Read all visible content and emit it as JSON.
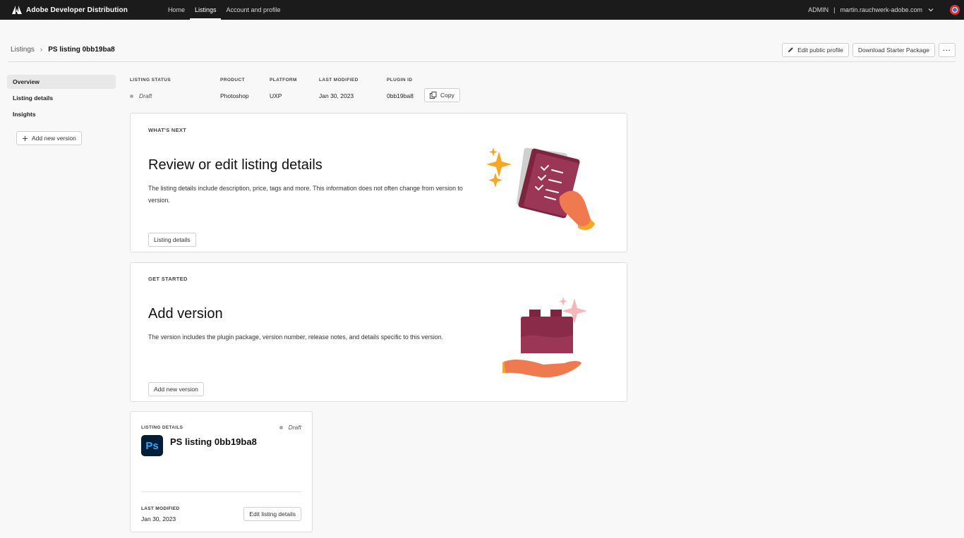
{
  "topnav": {
    "brand": "Adobe Developer Distribution",
    "links": [
      "Home",
      "Listings",
      "Account and profile"
    ],
    "active_link": "Listings",
    "role": "ADMIN",
    "separator": "|",
    "user": "martin.rauchwerk-adobe.com"
  },
  "breadcrumb": {
    "parent": "Listings",
    "current": "PS listing 0bb19ba8"
  },
  "header_actions": {
    "edit_profile": "Edit public profile",
    "download": "Download Starter Package",
    "more": "···"
  },
  "sidebar": {
    "items": [
      "Overview",
      "Listing details",
      "Insights"
    ],
    "active": "Overview",
    "add_version": "Add new version"
  },
  "status": {
    "listing_status_label": "LISTING STATUS",
    "listing_status": "Draft",
    "product_label": "PRODUCT",
    "product": "Photoshop",
    "platform_label": "PLATFORM",
    "platform": "UXP",
    "last_modified_label": "LAST MODIFIED",
    "last_modified": "Jan 30, 2023",
    "plugin_id_label": "PLUGIN ID",
    "plugin_id": "0bb19ba8",
    "copy": "Copy"
  },
  "whats_next": {
    "eyebrow": "WHAT'S NEXT",
    "title": "Review or edit listing details",
    "description": "The listing details include description, price, tags and more. This information does not often change from version to version.",
    "button": "Listing details"
  },
  "get_started": {
    "eyebrow": "GET STARTED",
    "title": "Add version",
    "description": "The version includes the plugin package, version number, release notes, and details specific to this version.",
    "button": "Add new version"
  },
  "listing_card": {
    "eyebrow": "LISTING DETAILS",
    "status": "Draft",
    "icon_text": "Ps",
    "title": "PS listing 0bb19ba8",
    "last_modified_label": "LAST MODIFIED",
    "last_modified": "Jan 30, 2023",
    "edit_button": "Edit listing details"
  },
  "colors": {
    "nav_bg": "#1b1b1b",
    "illustration_maroon": "#8a2b4a",
    "illustration_orange": "#f07a4f",
    "sparkle_yellow": "#f6a723",
    "sparkle_pink": "#f5b8b8",
    "ps_bg": "#001e36",
    "ps_fg": "#31a8ff"
  }
}
